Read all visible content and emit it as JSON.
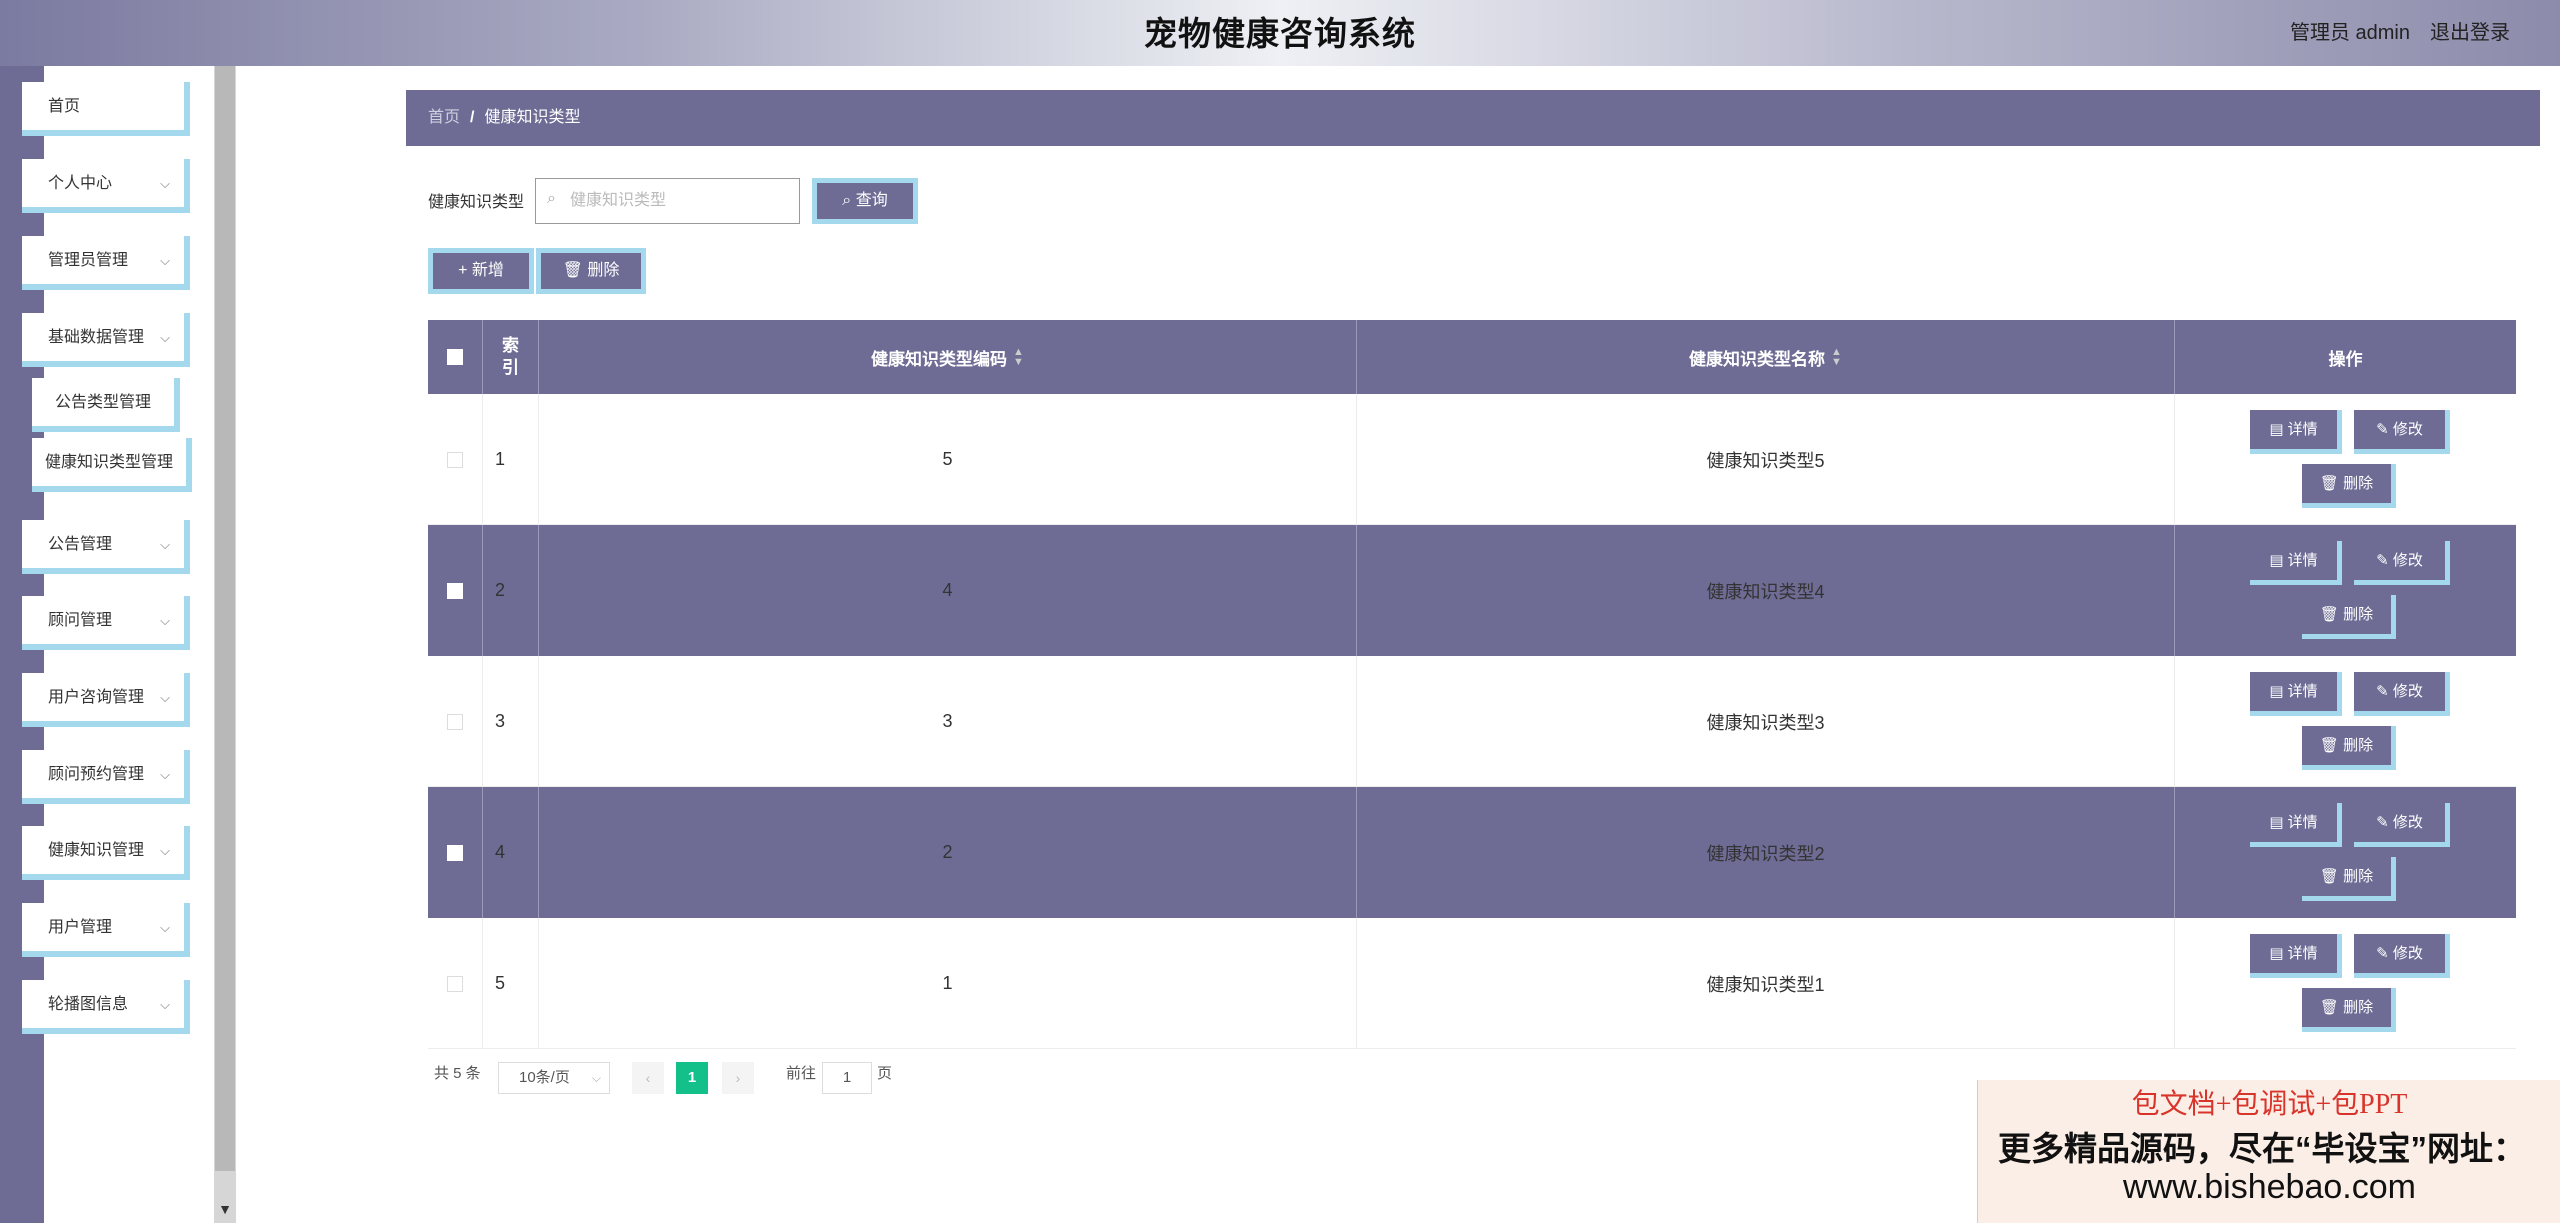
{
  "header": {
    "title": "宠物健康咨询系统",
    "admin": "管理员 admin",
    "logout": "退出登录"
  },
  "sidebar": {
    "items": [
      {
        "label": "首页",
        "chevron": false
      },
      {
        "label": "个人中心",
        "chevron": true
      },
      {
        "label": "管理员管理",
        "chevron": true
      },
      {
        "label": "基础数据管理",
        "chevron": true
      },
      {
        "label": "公告管理",
        "chevron": true
      },
      {
        "label": "顾问管理",
        "chevron": true
      },
      {
        "label": "用户咨询管理",
        "chevron": true
      },
      {
        "label": "顾问预约管理",
        "chevron": true
      },
      {
        "label": "健康知识管理",
        "chevron": true
      },
      {
        "label": "用户管理",
        "chevron": true
      },
      {
        "label": "轮播图信息",
        "chevron": true
      }
    ],
    "subitems": [
      {
        "label": "公告类型管理"
      },
      {
        "label": "健康知识类型管理"
      }
    ],
    "chevron_glyph": "⌵"
  },
  "breadcrumb": {
    "home": "首页",
    "separator": "/",
    "current": "健康知识类型"
  },
  "search": {
    "label": "健康知识类型",
    "placeholder": "健康知识类型",
    "value": "",
    "query_button": "查询"
  },
  "toolbar": {
    "add_button": "新增",
    "delete_button": "删除"
  },
  "table": {
    "headers": {
      "index": "索\n引",
      "code": "健康知识类型编码",
      "name": "健康知识类型名称",
      "actions": "操作"
    },
    "rows": [
      {
        "index": "1",
        "code": "5",
        "name": "健康知识类型5"
      },
      {
        "index": "2",
        "code": "4",
        "name": "健康知识类型4"
      },
      {
        "index": "3",
        "code": "3",
        "name": "健康知识类型3"
      },
      {
        "index": "4",
        "code": "2",
        "name": "健康知识类型2"
      },
      {
        "index": "5",
        "code": "1",
        "name": "健康知识类型1"
      }
    ],
    "row_actions": {
      "detail": "详情",
      "edit": "修改",
      "delete": "删除"
    }
  },
  "pagination": {
    "total": "共 5 条",
    "page_size": "10条/页",
    "current_page": "1",
    "goto_prefix": "前往",
    "goto_value": "1",
    "goto_suffix": "页"
  },
  "watermark": {
    "line1": "包文档+包调试+包PPT",
    "line2": "更多精品源码，尽在“毕设宝”网址：",
    "line3": "www.bishebao.com"
  },
  "colors": {
    "primary": "#6e6c94",
    "accent_border": "#a4d8ec",
    "page_active": "#13c08a",
    "watermark_red": "#d9342b"
  }
}
